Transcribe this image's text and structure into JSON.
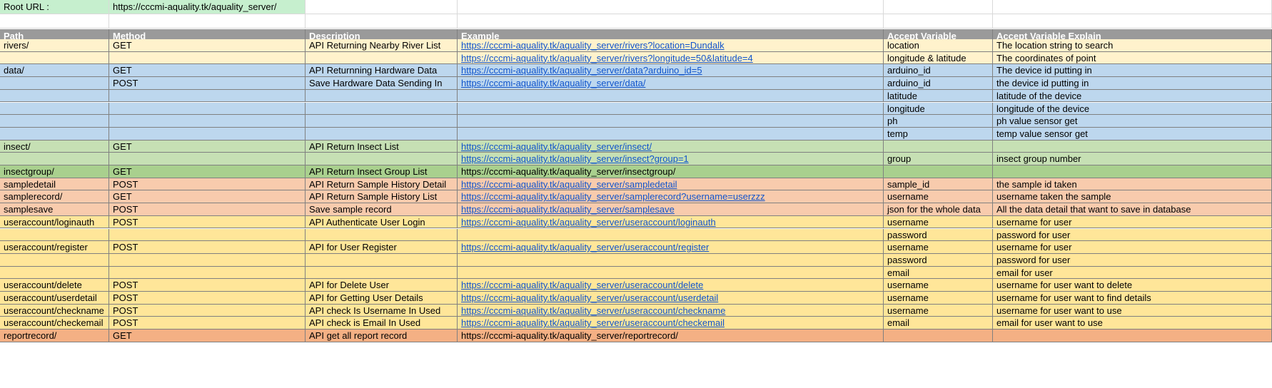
{
  "root": {
    "label": "Root URL :",
    "url": "https://cccmi-aquality.tk/aquality_server/"
  },
  "headers": [
    "Path",
    "Method",
    "Description",
    "Example",
    "Accept Variable",
    "Accept Variable Explain"
  ],
  "colors": {
    "root_bg": "#c6efce",
    "root_url_bg": "#c6efce",
    "header_bg": "#9a9a9a",
    "yellow": "#fff2cc",
    "blue": "#bdd7ee",
    "green": "#c6e0b4",
    "green_dark": "#a9d08e",
    "salmon": "#f8cbad",
    "orange": "#ffe699",
    "salmon_dark": "#f4b084",
    "link": "#1155cc"
  },
  "rows": [
    {
      "bg": "yellow",
      "path": "rivers/",
      "method": "GET",
      "desc": "API Returning Nearby River List",
      "example": "https://cccmi-aquality.tk/aquality_server/rivers?location=Dundalk",
      "link": true,
      "var": "location",
      "explain": "The location string to search"
    },
    {
      "bg": "yellow",
      "path": "",
      "method": "",
      "desc": "",
      "example": "https://cccmi-aquality.tk/aquality_server/rivers?longitude=50&latitude=4",
      "link": true,
      "var": "longitude & latitude",
      "explain": "The coordinates of point"
    },
    {
      "bg": "blue",
      "path": "data/",
      "method": "GET",
      "desc": "API Returnning Hardware Data",
      "example": "https://cccmi-aquality.tk/aquality_server/data?arduino_id=5",
      "link": true,
      "var": "arduino_id",
      "explain": "The device id putting in"
    },
    {
      "bg": "blue",
      "path": "",
      "method": "POST",
      "desc": "Save Hardware Data Sending In",
      "example": "https://cccmi-aquality.tk/aquality_server/data/",
      "link": true,
      "var": "arduino_id",
      "explain": "the device id putting in"
    },
    {
      "bg": "blue",
      "path": "",
      "method": "",
      "desc": "",
      "example": "",
      "link": false,
      "var": "latitude",
      "explain": "latitude of the device"
    },
    {
      "bg": "blue",
      "path": "",
      "method": "",
      "desc": "",
      "example": "",
      "link": false,
      "var": "longitude",
      "explain": "longitude of the device"
    },
    {
      "bg": "blue",
      "path": "",
      "method": "",
      "desc": "",
      "example": "",
      "link": false,
      "var": "ph",
      "explain": "ph value sensor get"
    },
    {
      "bg": "blue",
      "path": "",
      "method": "",
      "desc": "",
      "example": "",
      "link": false,
      "var": "temp",
      "explain": "temp value sensor get"
    },
    {
      "bg": "green",
      "path": "insect/",
      "method": "GET",
      "desc": "API Return Insect List",
      "example": "https://cccmi-aquality.tk/aquality_server/insect/",
      "link": true,
      "var": "",
      "explain": ""
    },
    {
      "bg": "green",
      "path": "",
      "method": "",
      "desc": "",
      "example": "https://cccmi-aquality.tk/aquality_server/insect?group=1",
      "link": true,
      "var": "group",
      "explain": "insect group number"
    },
    {
      "bg": "green_dark",
      "path": "insectgroup/",
      "method": "GET",
      "desc": "API Return Insect Group List",
      "example": "https://cccmi-aquality.tk/aquality_server/insectgroup/",
      "link": false,
      "var": "",
      "explain": ""
    },
    {
      "bg": "salmon",
      "path": "sampledetail",
      "method": "POST",
      "desc": "API Return Sample History Detail",
      "example": "https://cccmi-aquality.tk/aquality_server/sampledetail",
      "link": true,
      "var": "sample_id",
      "explain": "the sample id taken"
    },
    {
      "bg": "salmon",
      "path": "samplerecord/",
      "method": "GET",
      "desc": "API Return Sample History List",
      "example": "https://cccmi-aquality.tk/aquality_server/samplerecord?username=userzzz",
      "link": true,
      "var": "username",
      "explain": "username taken the sample"
    },
    {
      "bg": "salmon",
      "path": "samplesave",
      "method": "POST",
      "desc": "Save sample record",
      "example": "https://cccmi-aquality.tk/aquality_server/samplesave",
      "link": true,
      "var": "json for the whole data",
      "explain": "All the data detail that want to save in database"
    },
    {
      "bg": "orange",
      "path": "useraccount/loginauth",
      "method": "POST",
      "desc": "API Authenticate User Login",
      "example": "https://cccmi-aquality.tk/aquality_server/useraccount/loginauth",
      "link": true,
      "var": "username",
      "explain": "username for user"
    },
    {
      "bg": "orange",
      "path": "",
      "method": "",
      "desc": "",
      "example": "",
      "link": false,
      "var": "password",
      "explain": "password for user"
    },
    {
      "bg": "orange",
      "path": "useraccount/register",
      "method": "POST",
      "desc": "API for User Register",
      "example": "https://cccmi-aquality.tk/aquality_server/useraccount/register",
      "link": true,
      "var": "username",
      "explain": "username for user"
    },
    {
      "bg": "orange",
      "path": "",
      "method": "",
      "desc": "",
      "example": "",
      "link": false,
      "var": "password",
      "explain": "password for user"
    },
    {
      "bg": "orange",
      "path": "",
      "method": "",
      "desc": "",
      "example": "",
      "link": false,
      "var": "email",
      "explain": "email for user"
    },
    {
      "bg": "orange",
      "path": "useraccount/delete",
      "method": "POST",
      "desc": "API for Delete User",
      "example": "https://cccmi-aquality.tk/aquality_server/useraccount/delete",
      "link": true,
      "var": "username",
      "explain": "username for user want to delete"
    },
    {
      "bg": "orange",
      "path": "useraccount/userdetail",
      "method": "POST",
      "desc": "API for Getting User Details",
      "example": "https://cccmi-aquality.tk/aquality_server/useraccount/userdetail",
      "link": true,
      "var": "username",
      "explain": "username for user want to find details"
    },
    {
      "bg": "orange",
      "path": "useraccount/checkname",
      "method": "POST",
      "desc": "API check Is Username In Used",
      "example": "https://cccmi-aquality.tk/aquality_server/useraccount/checkname",
      "link": true,
      "var": "username",
      "explain": "username for user want to use"
    },
    {
      "bg": "orange",
      "path": "useraccount/checkemail",
      "method": "POST",
      "desc": "API check is Email In Used",
      "example": "https://cccmi-aquality.tk/aquality_server/useraccount/checkemail",
      "link": true,
      "var": "email",
      "explain": "email for user want to use"
    },
    {
      "bg": "salmon_dark",
      "path": "reportrecord/",
      "method": "GET",
      "desc": "API get all report record",
      "example": "https://cccmi-aquality.tk/aquality_server/reportrecord/",
      "link": false,
      "var": "",
      "explain": ""
    }
  ]
}
